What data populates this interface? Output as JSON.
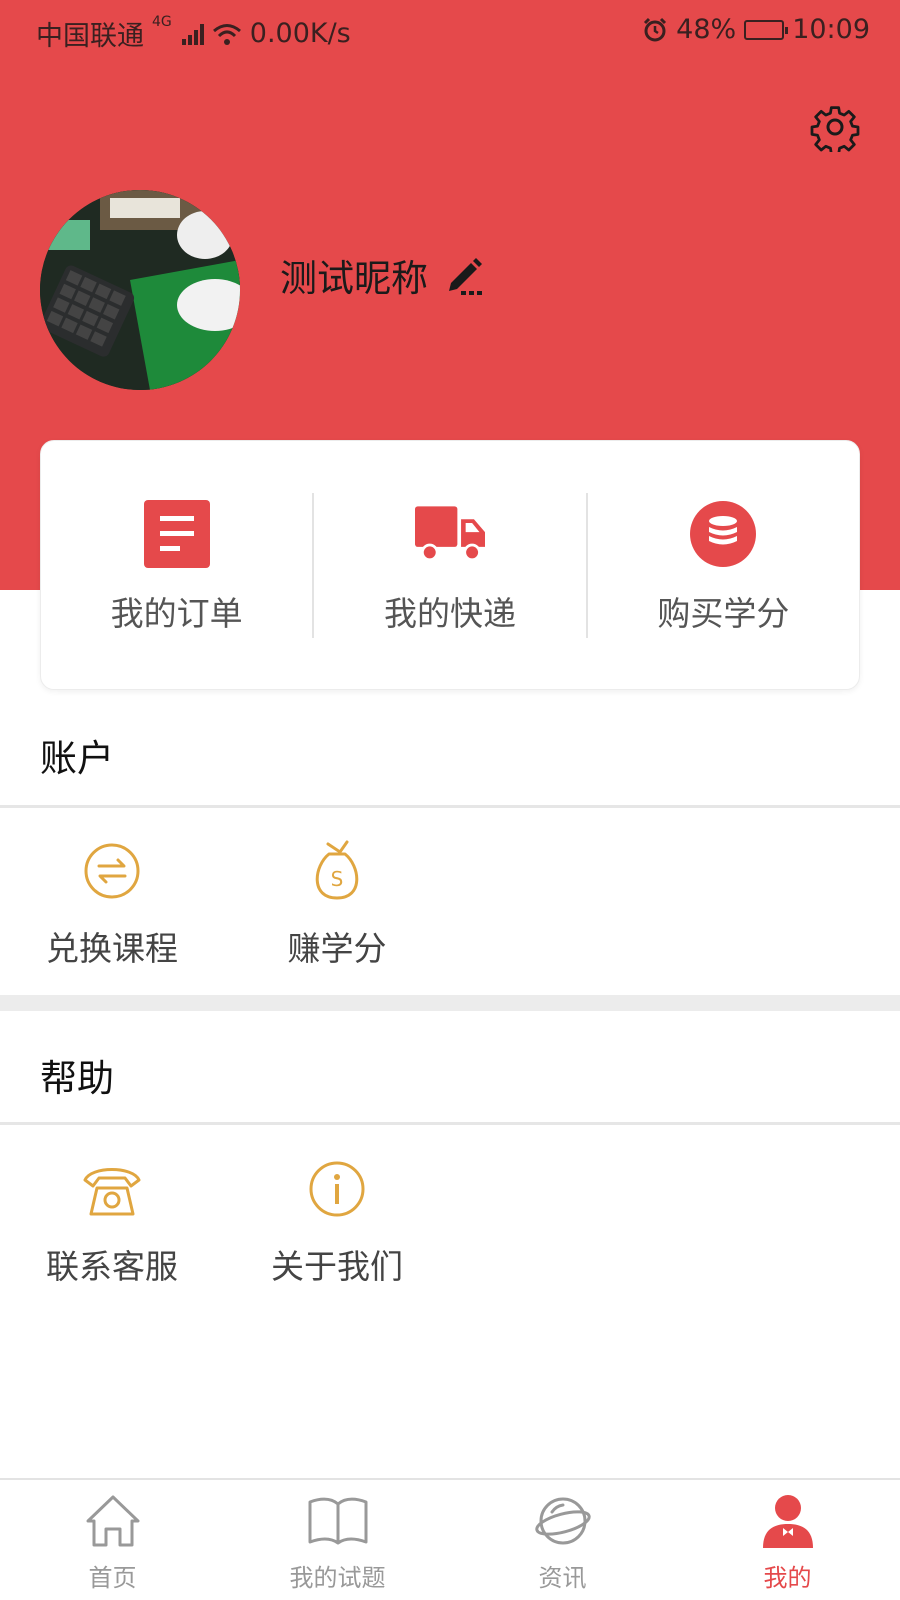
{
  "status_bar": {
    "carrier": "中国联通",
    "network_type": "4G",
    "speed": "0.00K/s",
    "battery_percent": "48%",
    "battery_level": 0.48,
    "time": "10:09"
  },
  "profile": {
    "nickname": "测试昵称"
  },
  "quick_actions": [
    {
      "label": "我的订单",
      "icon": "order-list-icon"
    },
    {
      "label": "我的快递",
      "icon": "delivery-truck-icon"
    },
    {
      "label": "购买学分",
      "icon": "credit-coins-icon"
    }
  ],
  "account_section": {
    "title": "账户",
    "items": [
      {
        "label": "兑换课程",
        "icon": "exchange-icon"
      },
      {
        "label": "赚学分",
        "icon": "money-bag-icon"
      }
    ]
  },
  "help_section": {
    "title": "帮助",
    "items": [
      {
        "label": "联系客服",
        "icon": "telephone-icon"
      },
      {
        "label": "关于我们",
        "icon": "info-icon"
      }
    ]
  },
  "tabbar": {
    "items": [
      {
        "label": "首页",
        "icon": "home-icon"
      },
      {
        "label": "我的试题",
        "icon": "book-icon"
      },
      {
        "label": "资讯",
        "icon": "planet-icon"
      },
      {
        "label": "我的",
        "icon": "user-icon"
      }
    ],
    "active_index": 3
  },
  "colors": {
    "primary_red": "#e5494b",
    "gold_icon": "#e0a640",
    "tab_inactive": "#999999"
  }
}
